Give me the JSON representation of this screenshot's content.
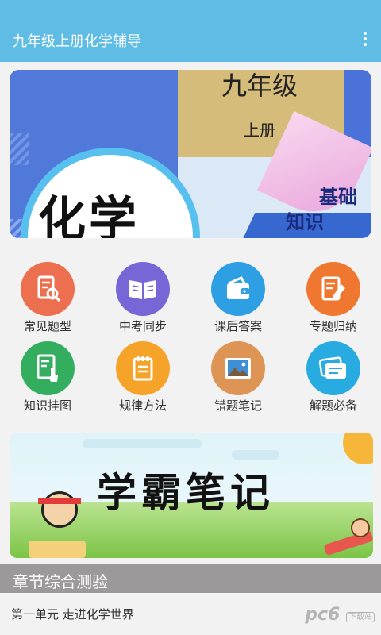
{
  "appbar": {
    "title": "九年级上册化学辅导",
    "menu_icon": "more-vert-icon"
  },
  "banner": {
    "grade": "九年级",
    "volume": "上册",
    "subject": "化学",
    "line1": "基础",
    "line2": "知识"
  },
  "grid": {
    "items": [
      {
        "label": "常见题型",
        "icon": "document-search-icon",
        "color": "#ec6f4f"
      },
      {
        "label": "中考同步",
        "icon": "open-book-icon",
        "color": "#7766d6"
      },
      {
        "label": "课后答案",
        "icon": "wallet-icon",
        "color": "#2f9fe4"
      },
      {
        "label": "专题归纳",
        "icon": "note-pen-icon",
        "color": "#f0772f"
      },
      {
        "label": "知识挂图",
        "icon": "tablet-touch-icon",
        "color": "#33ae5f"
      },
      {
        "label": "规律方法",
        "icon": "notepad-icon",
        "color": "#f6a329"
      },
      {
        "label": "错题笔记",
        "icon": "picture-icon",
        "color": "#de9454"
      },
      {
        "label": "解题必备",
        "icon": "cards-icon",
        "color": "#28abe0"
      }
    ]
  },
  "notes_banner": {
    "title": "学霸笔记"
  },
  "section": {
    "title": "章节综合测验",
    "items": [
      {
        "label": "第一单元 走进化学世界"
      }
    ]
  },
  "watermark": {
    "text": "pc6",
    "badge": "下载站"
  }
}
